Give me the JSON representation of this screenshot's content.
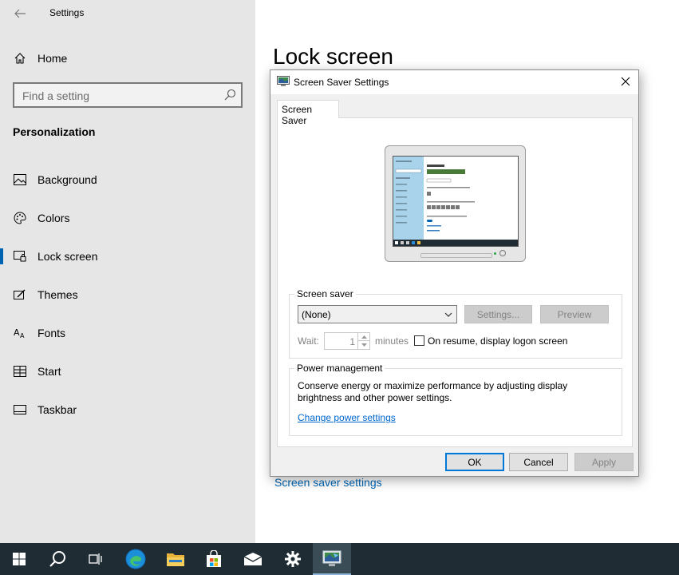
{
  "settings": {
    "window_title": "Settings",
    "home_label": "Home",
    "search_placeholder": "Find a setting",
    "section_title": "Personalization",
    "nav": [
      {
        "label": "Background",
        "icon": "image-icon"
      },
      {
        "label": "Colors",
        "icon": "palette-icon"
      },
      {
        "label": "Lock screen",
        "icon": "lock-screen-icon",
        "active": true
      },
      {
        "label": "Themes",
        "icon": "themes-icon"
      },
      {
        "label": "Fonts",
        "icon": "fonts-icon"
      },
      {
        "label": "Start",
        "icon": "start-icon"
      },
      {
        "label": "Taskbar",
        "icon": "taskbar-icon"
      }
    ]
  },
  "main": {
    "page_title": "Lock screen",
    "screen_saver_link": "Screen saver settings"
  },
  "dialog": {
    "title": "Screen Saver Settings",
    "tab_label": "Screen Saver",
    "screen_saver_group": "Screen saver",
    "selected_saver": "(None)",
    "settings_button": "Settings...",
    "preview_button": "Preview",
    "wait_label": "Wait:",
    "wait_value": "1",
    "minutes_label": "minutes",
    "logon_checkbox_label": "On resume, display logon screen",
    "logon_checked": false,
    "power_group": "Power management",
    "power_text": "Conserve energy or maximize performance by adjusting display brightness and other power settings.",
    "power_link": "Change power settings",
    "ok_button": "OK",
    "cancel_button": "Cancel",
    "apply_button": "Apply"
  },
  "taskbar": {
    "items": [
      "windows-start-icon",
      "search-icon",
      "task-view-icon",
      "edge-icon",
      "file-explorer-icon",
      "store-icon",
      "mail-icon",
      "settings-gear-icon",
      "screen-saver-app-icon"
    ],
    "active_item": "screen-saver-app-icon",
    "colors": {
      "background": "#1f2c33",
      "accent": "#0063b1"
    }
  }
}
